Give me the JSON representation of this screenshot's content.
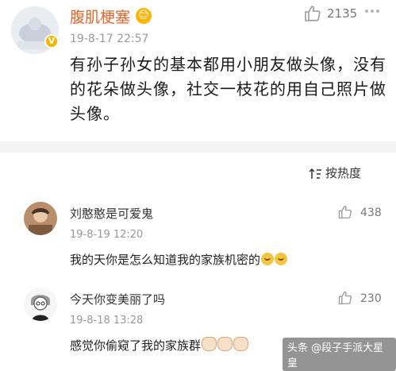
{
  "post": {
    "username": "腹肌梗塞",
    "user_emoji": "😊",
    "verified_badge": "V",
    "time": "19-8-17 22:57",
    "like_count": "2135",
    "text": "有孙子孙女的基本都用小朋友做头像，没有的花朵做头像，社交一枝花的用自己照片做头像。"
  },
  "sort": {
    "label": "按热度"
  },
  "comments": [
    {
      "name": "刘憨憨是可爱鬼",
      "time": "19-8-19 12:20",
      "text": "我的天你是怎么知道我的家族机密的",
      "like_count": "438"
    },
    {
      "name": "今天你变美丽了吗",
      "time": "19-8-18 13:28",
      "text": "感觉你偷窥了我的家族群",
      "like_count": "230"
    }
  ],
  "watermark": "头条 @段子手派大星皇",
  "icons": {
    "like": "thumbs-up-icon",
    "more": "more-dots-icon",
    "sort": "sort-arrows-icon"
  },
  "colors": {
    "username": "#e8652b",
    "badge": "#f7b500"
  }
}
